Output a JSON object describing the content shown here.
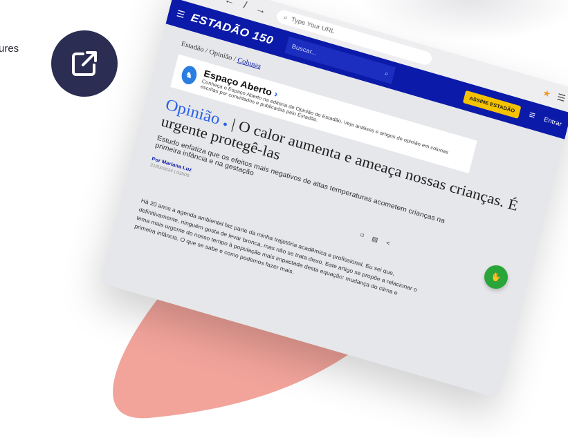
{
  "corner_text": "ures",
  "browser": {
    "url_placeholder": "Type Your URL",
    "back_arrow": "←",
    "forward_arrow": "→",
    "reload": "/"
  },
  "site": {
    "logo": "ESTADÃO 150",
    "search_placeholder": "Buscar...",
    "subscribe_label": "ASSINE ESTADÃO",
    "login_label": "Entrar",
    "breadcrumb": [
      "Estadão",
      "Opinião",
      "Colunas"
    ],
    "section_title": "Espaço Aberto",
    "section_desc": "Conheça o Espaço Aberto na editoria de Opinião do Estadão. Veja análises e artigos de opinião em colunas escritas por convidados e publicadas pelo Estadão.",
    "opinion_tag": "Opinião",
    "headline": "| O calor aumenta e ameaça nossas crianças. É urgente protegê-las",
    "subtitle": "Estudo enfatiza que os efeitos mais negativos de altas temperaturas acometem crianças na primeira infância e na gestação",
    "byline": "Por Mariana Luz",
    "date": "21/03/2024 | 03h00",
    "body": "Há 20 anos a agenda ambiental faz parte da minha trajetória acadêmica e profissional. Eu sei que, definitivamente, ninguém gosta de levar bronca, mas não se trata disso. Este artigo se propõe a relacionar o tema mais urgente do nosso tempo à população mais impactada desta equação: mudança do clima e primeira infância. O que se sabe e como podemos fazer mais."
  },
  "colors": {
    "header_blue": "#0b1aa8",
    "badge_navy": "#2b2d52",
    "blob_salmon": "#f2a49b",
    "subscribe_yellow": "#f5c200",
    "fab_green": "#2aa53a"
  }
}
